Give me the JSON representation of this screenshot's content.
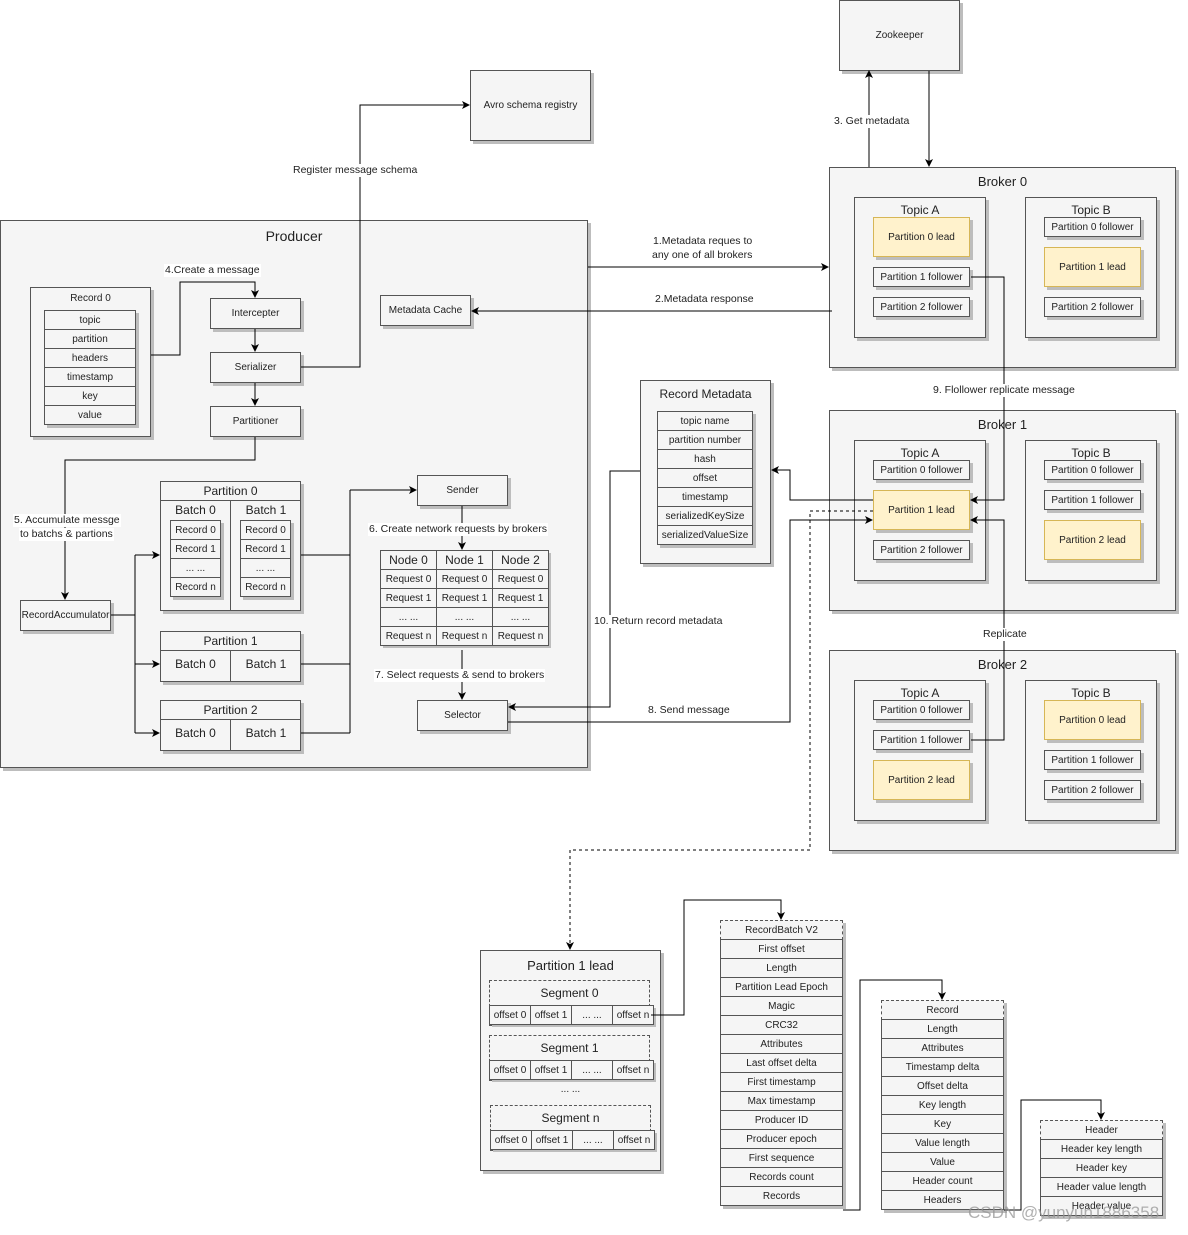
{
  "zookeeper": "Zookeeper",
  "avro": "Avro schema registry",
  "producer": {
    "title": "Producer",
    "record0": {
      "title": "Record 0",
      "fields": [
        "topic",
        "partition",
        "headers",
        "timestamp",
        "key",
        "value"
      ]
    },
    "intercepter": "Intercepter",
    "serializer": "Serializer",
    "partitioner": "Partitioner",
    "metadata_cache": "Metadata Cache",
    "record_accumulator": "RecordAccumulator",
    "partitions": [
      {
        "title": "Partition 0",
        "batches": [
          {
            "title": "Batch 0",
            "records": [
              "Record 0",
              "Record 1",
              "... ...",
              "Record n"
            ]
          },
          {
            "title": "Batch 1",
            "records": [
              "Record 0",
              "Record 1",
              "... ...",
              "Record n"
            ]
          }
        ]
      },
      {
        "title": "Partition 1",
        "batches": [
          {
            "title": "Batch 0"
          },
          {
            "title": "Batch 1"
          }
        ]
      },
      {
        "title": "Partition 2",
        "batches": [
          {
            "title": "Batch 0"
          },
          {
            "title": "Batch 1"
          }
        ]
      }
    ],
    "sender": "Sender",
    "selector": "Selector",
    "nodes": {
      "headers": [
        "Node 0",
        "Node 1",
        "Node 2"
      ],
      "rows": [
        [
          "Request 0",
          "Request 0",
          "Request 0"
        ],
        [
          "Request 1",
          "Request 1",
          "Request 1"
        ],
        [
          "... ...",
          "... ...",
          "... ..."
        ],
        [
          "Request n",
          "Request n",
          "Request n"
        ]
      ]
    }
  },
  "record_metadata": {
    "title": "Record Metadata",
    "fields": [
      "topic name",
      "partition number",
      "hash",
      "offset",
      "timestamp",
      "serializedKeySize",
      "serializedValueSize"
    ]
  },
  "brokers": [
    {
      "title": "Broker 0",
      "topic_a": {
        "title": "Topic A",
        "partitions": [
          "Partition 0 lead",
          "Partition 1 follower",
          "Partition 2 follower"
        ]
      },
      "topic_b": {
        "title": "Topic B",
        "partitions": [
          "Partition 0 follower",
          "Partition 1 lead",
          "Partition 2 follower"
        ]
      }
    },
    {
      "title": "Broker 1",
      "topic_a": {
        "title": "Topic A",
        "partitions": [
          "Partition 0 follower",
          "Partition 1 lead",
          "Partition 2 follower"
        ]
      },
      "topic_b": {
        "title": "Topic B",
        "partitions": [
          "Partition 0 follower",
          "Partition 1 follower",
          "Partition 2 lead"
        ]
      }
    },
    {
      "title": "Broker 2",
      "topic_a": {
        "title": "Topic A",
        "partitions": [
          "Partition 0 follower",
          "Partition 1 follower",
          "Partition 2 lead"
        ]
      },
      "topic_b": {
        "title": "Topic B",
        "partitions": [
          "Partition 0 lead",
          "Partition 1 follower",
          "Partition 2 follower"
        ]
      }
    }
  ],
  "labels": {
    "get_metadata": "3. Get metadata",
    "register_schema": "Register message schema",
    "create_message": "4.Create a message",
    "accumulate_1": "5. Accumulate messge",
    "accumulate_2": "to batchs & partions",
    "create_requests": "6. Create network requests by brokers",
    "select_requests": "7. Select requests & send to brokers",
    "metadata_request_1": "1.Metadata reques to",
    "metadata_request_2": "any one of all brokers",
    "metadata_response": "2.Metadata response",
    "follower_replicate": "9. Flollower replicate message",
    "replicate": "Replicate",
    "return_metadata": "10. Return record metadata",
    "send_message": "8. Send message"
  },
  "partition_lead": {
    "title": "Partition 1 lead",
    "segments": [
      {
        "title": "Segment 0",
        "offsets": [
          "offset 0",
          "offset 1",
          "... ...",
          "offset n"
        ]
      },
      {
        "title": "Segment 1",
        "offsets": [
          "offset 0",
          "offset 1",
          "... ...",
          "offset n"
        ]
      },
      {
        "title": "Segment n",
        "offsets": [
          "offset 0",
          "offset 1",
          "... ...",
          "offset n"
        ]
      }
    ],
    "ellipsis": "... ..."
  },
  "record_batch": [
    "RecordBatch V2",
    "First offset",
    "Length",
    "Partition Lead Epoch",
    "Magic",
    "CRC32",
    "Attributes",
    "Last offset delta",
    "First timestamp",
    "Max timestamp",
    "Producer ID",
    "Producer epoch",
    "First sequence",
    "Records count",
    "Records"
  ],
  "record": [
    "Record",
    "Length",
    "Attributes",
    "Timestamp delta",
    "Offset delta",
    "Key length",
    "Key",
    "Value length",
    "Value",
    "Header count",
    "Headers"
  ],
  "header": [
    "Header",
    "Header key length",
    "Header key",
    "Header value length",
    "Header value"
  ],
  "watermark": "CSDN @yunyun1886358",
  "colors": {
    "leader_fill": "#fff2cc",
    "leader_border": "#d6b656",
    "box_fill": "#f5f5f5"
  }
}
